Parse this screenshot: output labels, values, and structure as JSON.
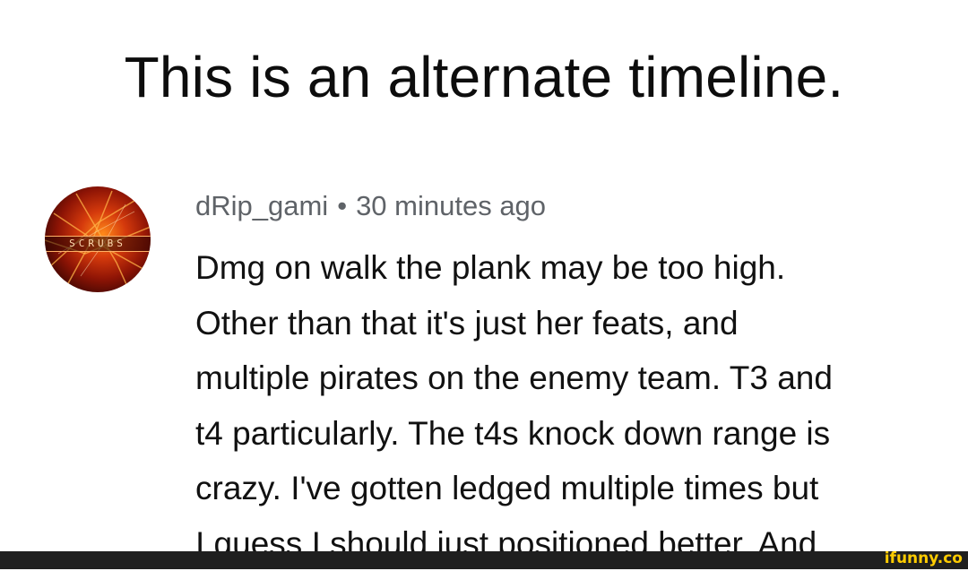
{
  "headline": "This is an alternate timeline.",
  "comment": {
    "avatar_label": "SCRUBS",
    "username": "dRip_gami",
    "separator": "•",
    "timestamp": "30 minutes ago",
    "lines": [
      "Dmg on walk the plank may be too high.",
      "Other than that it's just her feats, and",
      "multiple pirates on the enemy team. T3 and",
      "t4 particularly. The t4s knock down range is",
      "crazy. I've gotten ledged multiple times but",
      "I guess I should just positioned better. And"
    ]
  },
  "watermark": "ifunny.co",
  "colors": {
    "background": "#ffffff",
    "text": "#111111",
    "meta_text": "#5f6368",
    "footer_bar": "#1f1f1f",
    "watermark": "#ffcc00"
  }
}
